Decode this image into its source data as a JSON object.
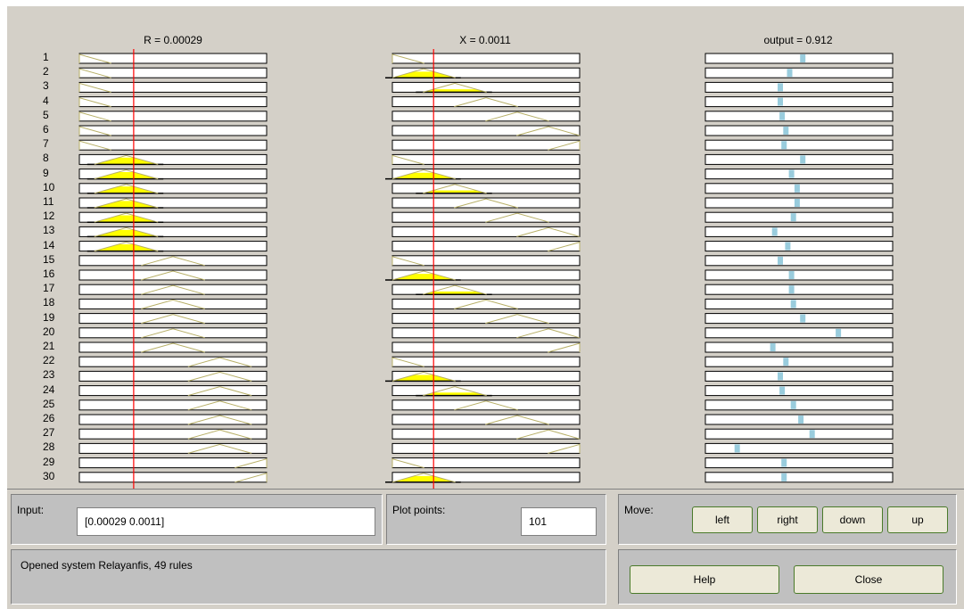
{
  "columns": [
    {
      "title": "R = 0.00029"
    },
    {
      "title": "X = 0.0011"
    },
    {
      "title": "output = 0.912"
    }
  ],
  "rules": {
    "visible_numbers": [
      "1",
      "2",
      "3",
      "4",
      "5",
      "6",
      "7",
      "8",
      "9",
      "10",
      "11",
      "12",
      "13",
      "14",
      "15",
      "16",
      "17",
      "18",
      "19",
      "20",
      "21",
      "22",
      "23",
      "24",
      "25",
      "26",
      "27",
      "28",
      "29",
      "30"
    ],
    "input_R_crosshair_fraction": 0.29,
    "input_X_crosshair_fraction": 0.22,
    "r_mf_index": [
      1,
      1,
      1,
      1,
      1,
      1,
      1,
      2,
      2,
      2,
      2,
      2,
      2,
      2,
      3,
      3,
      3,
      3,
      3,
      3,
      3,
      4,
      4,
      4,
      4,
      4,
      4,
      4,
      5,
      5
    ],
    "x_mf_index": [
      1,
      2,
      3,
      4,
      5,
      6,
      7,
      1,
      2,
      3,
      4,
      5,
      6,
      7,
      1,
      2,
      3,
      4,
      5,
      6,
      7,
      1,
      2,
      3,
      4,
      5,
      6,
      7,
      1,
      2
    ],
    "output_fraction": [
      0.52,
      0.45,
      0.4,
      0.4,
      0.41,
      0.43,
      0.42,
      0.52,
      0.46,
      0.49,
      0.49,
      0.47,
      0.37,
      0.44,
      0.4,
      0.46,
      0.46,
      0.47,
      0.52,
      0.71,
      0.36,
      0.43,
      0.4,
      0.41,
      0.47,
      0.51,
      0.57,
      0.17,
      0.42,
      0.42
    ]
  },
  "colors": {
    "rule_box_border": "#000000",
    "mf_outline": "#b8b068",
    "mf_fill": "#ffff00",
    "crosshair": "#ff0000",
    "output_marker": "#99ccdd",
    "output_marker_active": "#0000ee"
  },
  "input": {
    "label": "Input:",
    "value": "[0.00029 0.0011]"
  },
  "plot_points": {
    "label": "Plot points:",
    "value": "101"
  },
  "move": {
    "label": "Move:",
    "left": "left",
    "right": "right",
    "down": "down",
    "up": "up"
  },
  "status": {
    "text": "Opened system Relayanfis, 49 rules"
  },
  "buttons": {
    "help": "Help",
    "close": "Close"
  }
}
